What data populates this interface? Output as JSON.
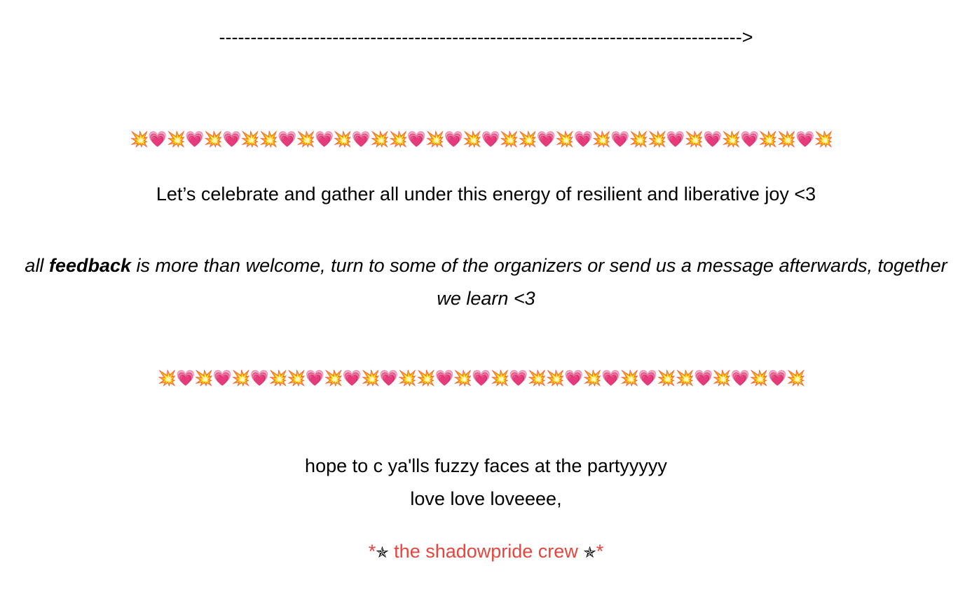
{
  "arrow_text": "----------------------------------------------------------------------------------->",
  "divider_top": "💥💗💥💗💥💗💥💥💗💥💗💥💗💥💥💗💥💗💥💗💥💥💗💥💗💥💗💥💥💗💥💗💥💗💥💥💗💥",
  "divider_bottom": "💥💗💥💗💥💗💥💥💗💥💗💥💗💥💥💗💥💗💥💗💥💥💗💥💗💥💗💥💥💗💥💗💥💗💥",
  "celebrate_text": "Let’s celebrate and gather all under this energy of resilient and liberative joy <3",
  "feedback": {
    "prefix": "all ",
    "bold": "feedback",
    "suffix": " is more than welcome, turn to some of the organizers or send us a message afterwards, together we learn <3"
  },
  "hope_text": "hope to c ya'lls fuzzy faces at the partyyyyy",
  "love_text": "love love loveeee,",
  "signature": {
    "left_mark": "*",
    "star_icon": "✯",
    "crew_name": " the shadowpride crew ",
    "right_mark": "*"
  },
  "colors": {
    "signature": "#e8453c"
  }
}
